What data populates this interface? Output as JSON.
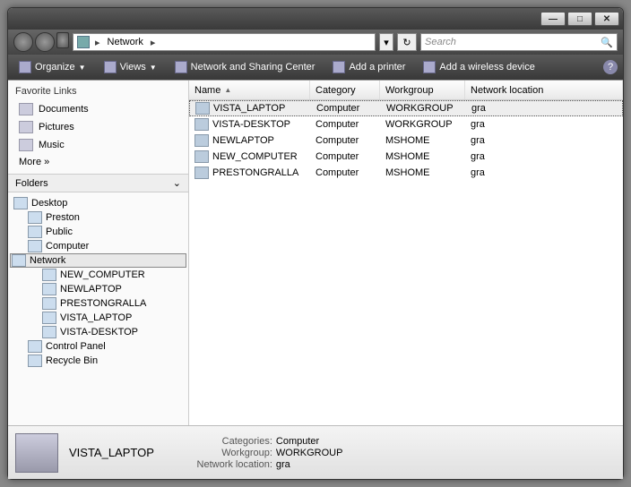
{
  "titlebar": {
    "min": "—",
    "max": "□",
    "close": "✕"
  },
  "address": {
    "root_label": "Network",
    "arrow": "▸"
  },
  "search": {
    "placeholder": "Search"
  },
  "toolbar": {
    "organize": "Organize",
    "views": "Views",
    "sharing": "Network and Sharing Center",
    "add_printer": "Add a printer",
    "add_wireless": "Add a wireless device"
  },
  "fav": {
    "title": "Favorite Links",
    "documents": "Documents",
    "pictures": "Pictures",
    "music": "Music",
    "more": "More »"
  },
  "folders": {
    "header": "Folders",
    "items": [
      {
        "label": "Desktop",
        "indent": 0
      },
      {
        "label": "Preston",
        "indent": 1
      },
      {
        "label": "Public",
        "indent": 1
      },
      {
        "label": "Computer",
        "indent": 1
      },
      {
        "label": "Network",
        "indent": 1,
        "selected": true
      },
      {
        "label": "NEW_COMPUTER",
        "indent": 2
      },
      {
        "label": "NEWLAPTOP",
        "indent": 2
      },
      {
        "label": "PRESTONGRALLA",
        "indent": 2
      },
      {
        "label": "VISTA_LAPTOP",
        "indent": 2
      },
      {
        "label": "VISTA-DESKTOP",
        "indent": 2
      },
      {
        "label": "Control Panel",
        "indent": 1
      },
      {
        "label": "Recycle Bin",
        "indent": 1
      }
    ]
  },
  "columns": {
    "name": "Name",
    "category": "Category",
    "workgroup": "Workgroup",
    "location": "Network location"
  },
  "rows": [
    {
      "name": "VISTA_LAPTOP",
      "category": "Computer",
      "workgroup": "WORKGROUP",
      "location": "gra",
      "selected": true
    },
    {
      "name": "VISTA-DESKTOP",
      "category": "Computer",
      "workgroup": "WORKGROUP",
      "location": "gra"
    },
    {
      "name": "NEWLAPTOP",
      "category": "Computer",
      "workgroup": "MSHOME",
      "location": "gra"
    },
    {
      "name": "NEW_COMPUTER",
      "category": "Computer",
      "workgroup": "MSHOME",
      "location": "gra"
    },
    {
      "name": "PRESTONGRALLA",
      "category": "Computer",
      "workgroup": "MSHOME",
      "location": "gra"
    }
  ],
  "details": {
    "name": "VISTA_LAPTOP",
    "cat_k": "Categories:",
    "cat_v": "Computer",
    "wg_k": "Workgroup:",
    "wg_v": "WORKGROUP",
    "loc_k": "Network location:",
    "loc_v": "gra"
  }
}
